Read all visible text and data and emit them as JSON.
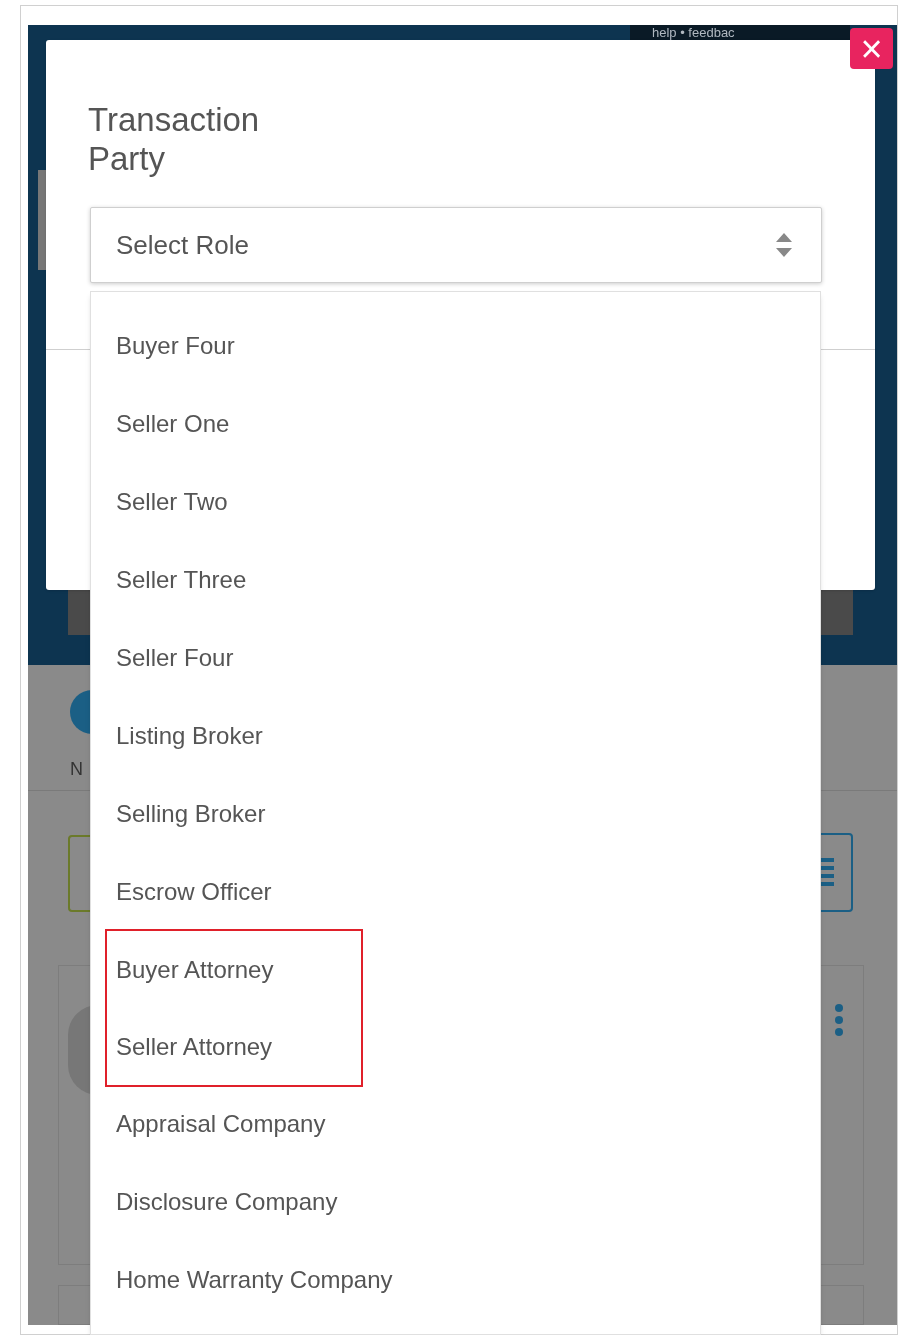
{
  "background": {
    "top_links": "help • feedbac",
    "partial_label": "N"
  },
  "modal": {
    "title": "Transaction Party",
    "close_label": "×"
  },
  "role_select": {
    "placeholder": "Select Role",
    "expanded": true
  },
  "options": [
    {
      "label": "Buyer Four",
      "highlighted": false
    },
    {
      "label": "Seller One",
      "highlighted": false
    },
    {
      "label": "Seller Two",
      "highlighted": false
    },
    {
      "label": "Seller Three",
      "highlighted": false
    },
    {
      "label": "Seller Four",
      "highlighted": false
    },
    {
      "label": "Listing Broker",
      "highlighted": false
    },
    {
      "label": "Selling Broker",
      "highlighted": false
    },
    {
      "label": "Escrow Officer",
      "highlighted": false
    },
    {
      "label": "Buyer Attorney",
      "highlighted": true
    },
    {
      "label": "Seller Attorney",
      "highlighted": true
    },
    {
      "label": "Appraisal Company",
      "highlighted": false
    },
    {
      "label": "Disclosure Company",
      "highlighted": false
    },
    {
      "label": "Home Warranty Company",
      "highlighted": false
    }
  ]
}
